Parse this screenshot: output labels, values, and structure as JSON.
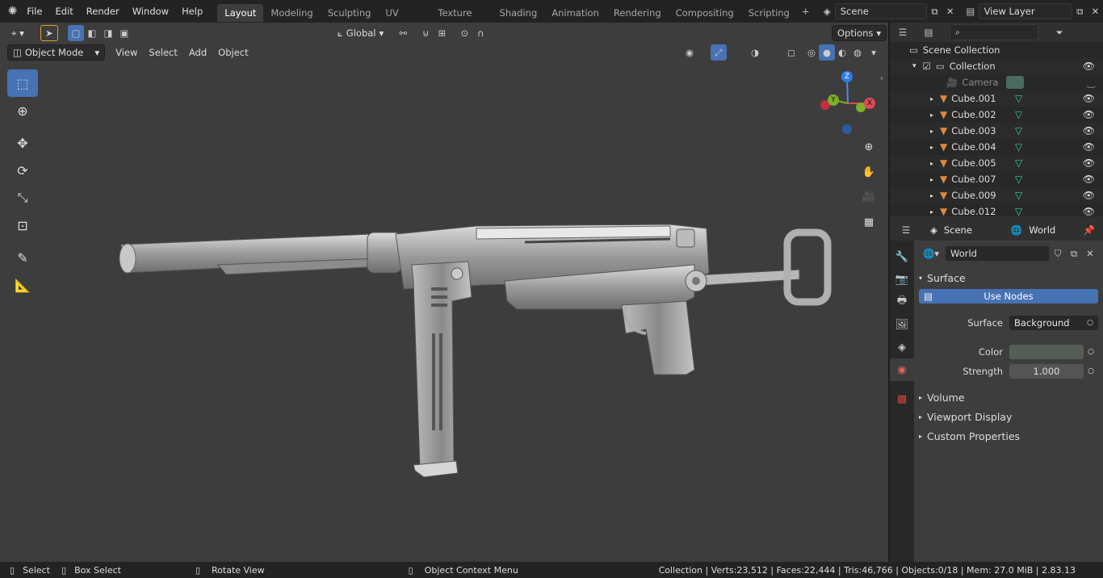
{
  "menu": [
    "File",
    "Edit",
    "Render",
    "Window",
    "Help"
  ],
  "workspaces": [
    "Layout",
    "Modeling",
    "Sculpting",
    "UV Editing",
    "Texture Paint",
    "Shading",
    "Animation",
    "Rendering",
    "Compositing",
    "Scripting"
  ],
  "scene": {
    "label": "Scene"
  },
  "viewlayer": {
    "label": "View Layer"
  },
  "tool_header": {
    "orientation": "Global",
    "options": "Options"
  },
  "viewport_header": {
    "mode": "Object Mode",
    "view": "View",
    "select": "Select",
    "add": "Add",
    "object": "Object"
  },
  "gizmo": {
    "z": "Z",
    "y": "Y",
    "x": "X"
  },
  "outliner": {
    "root": "Scene Collection",
    "collection": "Collection",
    "items": [
      "Camera",
      "Cube.001",
      "Cube.002",
      "Cube.003",
      "Cube.004",
      "Cube.005",
      "Cube.007",
      "Cube.009",
      "Cube.012"
    ]
  },
  "properties": {
    "context_scene": "Scene",
    "context_world": "World",
    "world_name": "World",
    "surface_section": "Surface",
    "use_nodes": "Use Nodes",
    "surface_label": "Surface",
    "surface_value": "Background",
    "color_label": "Color",
    "strength_label": "Strength",
    "strength_value": "1.000",
    "sections": [
      "Volume",
      "Viewport Display",
      "Custom Properties"
    ]
  },
  "status": {
    "select": "Select",
    "box_select": "Box Select",
    "rotate": "Rotate View",
    "context_menu": "Object Context Menu",
    "stats": "Collection | Verts:23,512 | Faces:22,444 | Tris:46,766 | Objects:0/18 | Mem: 27.0 MiB | 2.83.13"
  },
  "colors": {
    "accent": "#4772b3",
    "viewport_bg": "#3d3d3d",
    "object_orange": "#e08a3c",
    "mesh_green": "#3fc7a0"
  }
}
